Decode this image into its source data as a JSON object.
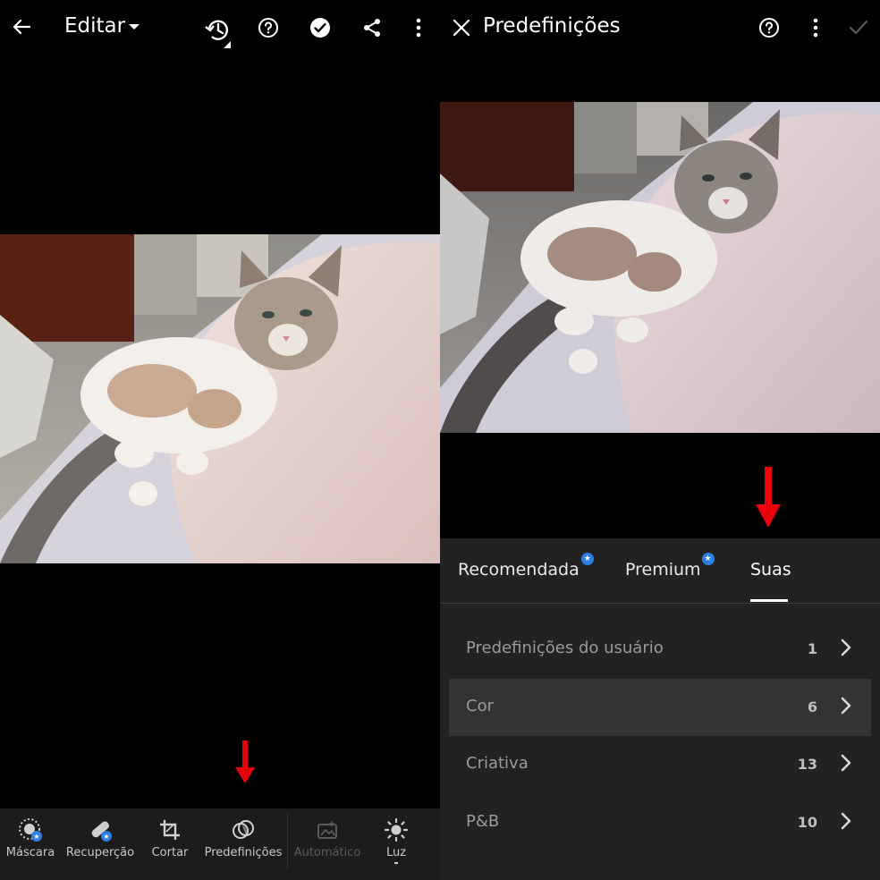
{
  "left": {
    "title": "Editar",
    "icons": [
      "back-arrow-icon",
      "dropdown-caret-icon",
      "history-icon",
      "help-icon",
      "checkmark-circle-icon",
      "share-icon",
      "more-vertical-icon"
    ],
    "toolbar": [
      {
        "label": "Máscara",
        "icon": "mask-icon",
        "premium": true
      },
      {
        "label": "Recuperção",
        "icon": "healing-icon",
        "premium": true
      },
      {
        "label": "Cortar",
        "icon": "crop-icon"
      },
      {
        "label": "Predefinições",
        "icon": "presets-icon"
      },
      {
        "label": "Automático",
        "icon": "auto-icon",
        "disabled": true
      },
      {
        "label": "Luz",
        "icon": "sun-icon"
      }
    ]
  },
  "right": {
    "title": "Predefinições",
    "icons": [
      "close-icon",
      "help-icon",
      "more-vertical-icon",
      "checkmark-icon"
    ],
    "tabs": [
      {
        "label": "Recomendada",
        "premium": true
      },
      {
        "label": "Premium",
        "premium": true
      },
      {
        "label": "Suas",
        "active": true
      }
    ],
    "groups": [
      {
        "label": "Predefinições do usuário",
        "count": "1"
      },
      {
        "label": "Cor",
        "count": "6",
        "highlighted": true
      },
      {
        "label": "Criativa",
        "count": "13"
      },
      {
        "label": "P&B",
        "count": "10"
      }
    ]
  },
  "colors": {
    "annotation_arrow": "#e8000b",
    "premium_badge": "#2d7fe3",
    "panel": "#222222",
    "toolbar": "#1c1c1c"
  }
}
